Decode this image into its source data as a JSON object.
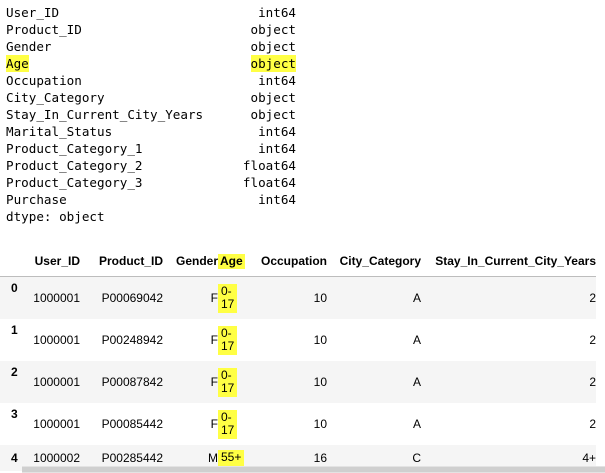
{
  "dtypes": {
    "rows": [
      {
        "name": "User_ID",
        "type": "int64",
        "highlight": false
      },
      {
        "name": "Product_ID",
        "type": "object",
        "highlight": false
      },
      {
        "name": "Gender",
        "type": "object",
        "highlight": false
      },
      {
        "name": "Age",
        "type": "object",
        "highlight": true
      },
      {
        "name": "Occupation",
        "type": "int64",
        "highlight": false
      },
      {
        "name": "City_Category",
        "type": "object",
        "highlight": false
      },
      {
        "name": "Stay_In_Current_City_Years",
        "type": "object",
        "highlight": false
      },
      {
        "name": "Marital_Status",
        "type": "int64",
        "highlight": false
      },
      {
        "name": "Product_Category_1",
        "type": "int64",
        "highlight": false
      },
      {
        "name": "Product_Category_2",
        "type": "float64",
        "highlight": false
      },
      {
        "name": "Product_Category_3",
        "type": "float64",
        "highlight": false
      },
      {
        "name": "Purchase",
        "type": "int64",
        "highlight": false
      }
    ],
    "footer": "dtype: object"
  },
  "table": {
    "columns": [
      "",
      "User_ID",
      "Product_ID",
      "Gender",
      "Age",
      "Occupation",
      "City_Category",
      "Stay_In_Current_City_Years"
    ],
    "rows": [
      {
        "index": "0",
        "user_id": "1000001",
        "product_id": "P00069042",
        "gender": "F",
        "age_line1": "0-",
        "age_line2": "17",
        "occupation": "10",
        "city_category": "A",
        "stay_years": "2"
      },
      {
        "index": "1",
        "user_id": "1000001",
        "product_id": "P00248942",
        "gender": "F",
        "age_line1": "0-",
        "age_line2": "17",
        "occupation": "10",
        "city_category": "A",
        "stay_years": "2"
      },
      {
        "index": "2",
        "user_id": "1000001",
        "product_id": "P00087842",
        "gender": "F",
        "age_line1": "0-",
        "age_line2": "17",
        "occupation": "10",
        "city_category": "A",
        "stay_years": "2"
      },
      {
        "index": "3",
        "user_id": "1000001",
        "product_id": "P00085442",
        "gender": "F",
        "age_line1": "0-",
        "age_line2": "17",
        "occupation": "10",
        "city_category": "A",
        "stay_years": "2"
      },
      {
        "index": "4",
        "user_id": "1000002",
        "product_id": "P00285442",
        "gender": "M",
        "age_line1": "55+",
        "age_line2": "",
        "occupation": "16",
        "city_category": "C",
        "stay_years": "4+"
      }
    ]
  },
  "colors": {
    "highlight": "#ffff44",
    "stripe": "#f5f5f5"
  }
}
